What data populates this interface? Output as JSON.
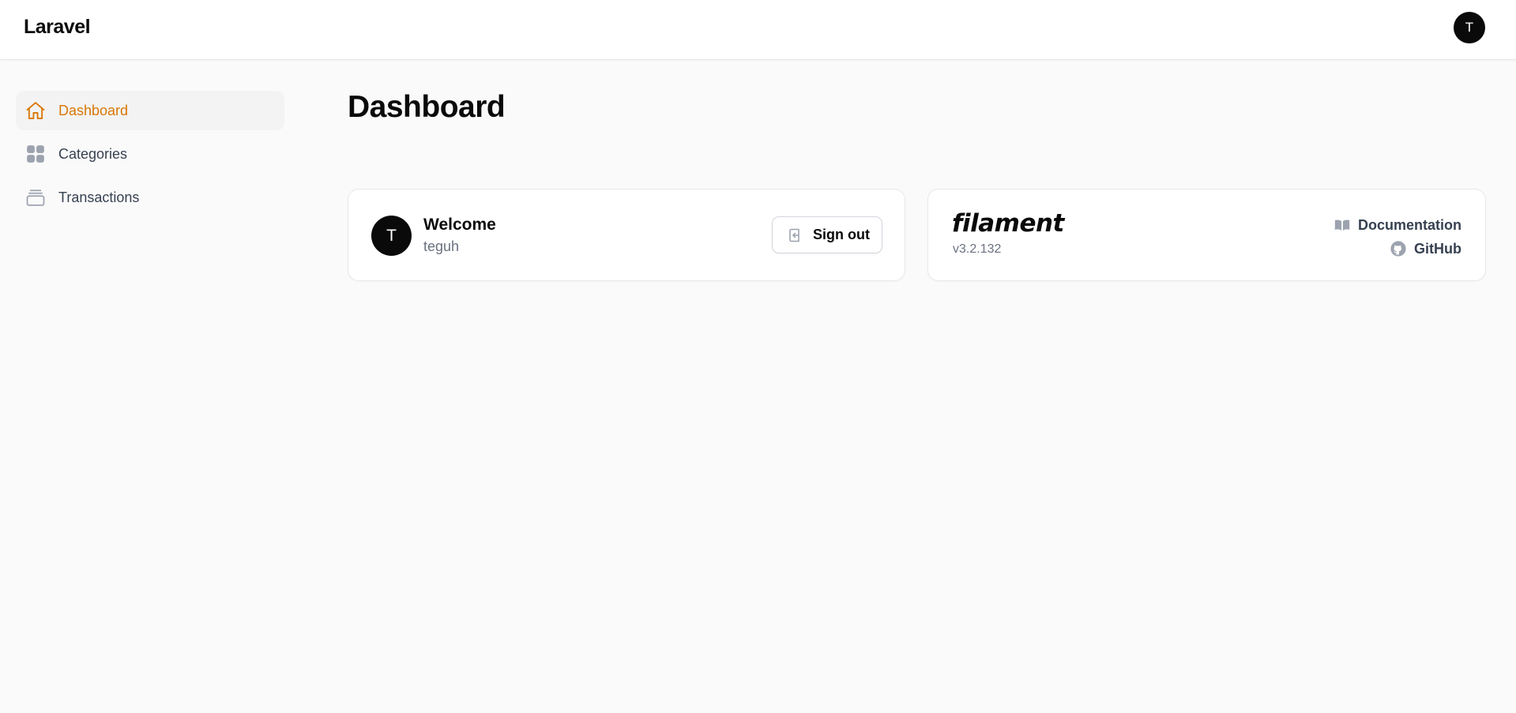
{
  "header": {
    "brand": "Laravel",
    "avatar_initial": "T"
  },
  "sidebar": {
    "items": [
      {
        "label": "Dashboard",
        "icon": "home-icon",
        "active": true
      },
      {
        "label": "Categories",
        "icon": "grid-icon",
        "active": false
      },
      {
        "label": "Transactions",
        "icon": "archive-icon",
        "active": false
      }
    ]
  },
  "main": {
    "title": "Dashboard",
    "welcome_card": {
      "avatar_initial": "T",
      "title": "Welcome",
      "username": "teguh",
      "signout_label": "Sign out"
    },
    "filament_card": {
      "logo_text": "filament",
      "version": "v3.2.132",
      "documentation_label": "Documentation",
      "github_label": "GitHub"
    }
  },
  "colors": {
    "accent": "#d97706",
    "text": "#0a0a0a",
    "muted": "#6b7280",
    "background": "#fafafa"
  }
}
